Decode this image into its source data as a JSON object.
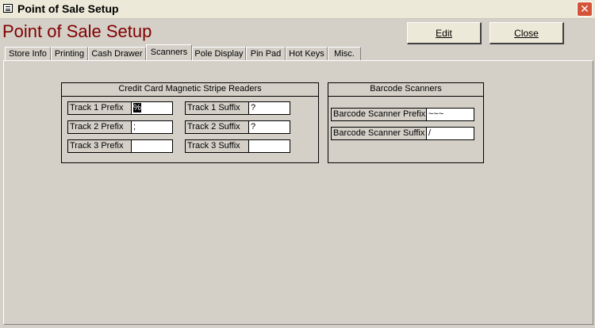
{
  "window": {
    "title": "Point of Sale Setup",
    "close_glyph": "✕"
  },
  "form": {
    "title": "Point of Sale Setup",
    "edit_label": "Edit",
    "close_label": "Close"
  },
  "tabs": [
    {
      "label": "Store Info"
    },
    {
      "label": "Printing"
    },
    {
      "label": "Cash Drawer"
    },
    {
      "label": "Scanners"
    },
    {
      "label": "Pole Display"
    },
    {
      "label": "Pin Pad"
    },
    {
      "label": "Hot Keys"
    },
    {
      "label": "Misc."
    }
  ],
  "active_tab": "Scanners",
  "credit_card": {
    "header": "Credit Card Magnetic Stripe Readers",
    "track1_prefix_label": "Track 1 Prefix",
    "track1_prefix_value": "%",
    "track2_prefix_label": "Track 2 Prefix",
    "track2_prefix_value": ";",
    "track3_prefix_label": "Track 3 Prefix",
    "track3_prefix_value": "",
    "track1_suffix_label": "Track 1 Suffix",
    "track1_suffix_value": "?",
    "track2_suffix_label": "Track 2 Suffix",
    "track2_suffix_value": "?",
    "track3_suffix_label": "Track 3 Suffix",
    "track3_suffix_value": ""
  },
  "barcode": {
    "header": "Barcode Scanners",
    "prefix_label": "Barcode Scanner Prefix",
    "prefix_value": "~~~",
    "suffix_label": "Barcode Scanner Suffix",
    "suffix_value": "/"
  }
}
